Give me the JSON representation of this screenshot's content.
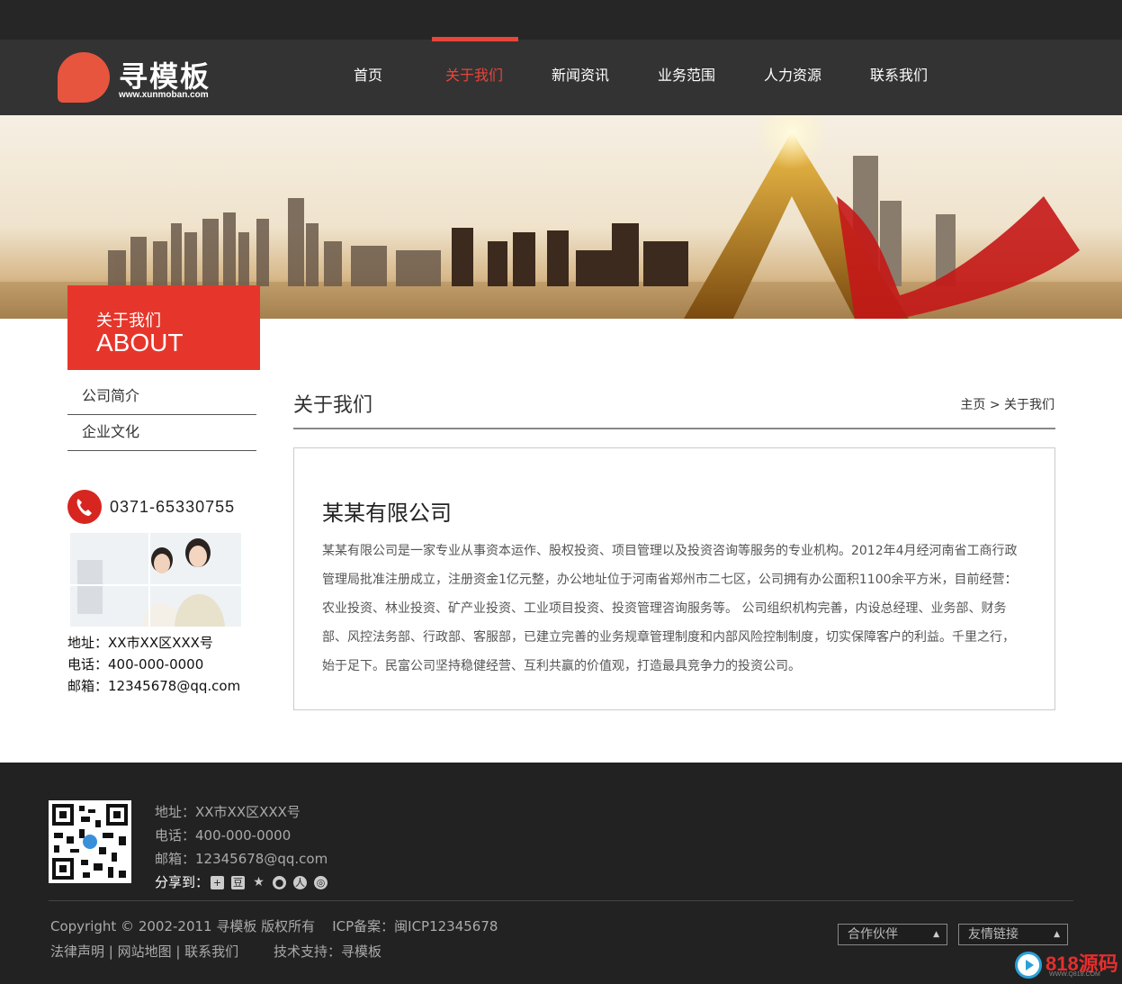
{
  "header": {
    "logo_text": "寻模板",
    "logo_url_text": "www.xunmoban.com",
    "nav": [
      {
        "label": "首页",
        "active": false
      },
      {
        "label": "关于我们",
        "active": true
      },
      {
        "label": "新闻资讯",
        "active": false
      },
      {
        "label": "业务范围",
        "active": false
      },
      {
        "label": "人力资源",
        "active": false
      },
      {
        "label": "联系我们",
        "active": false
      }
    ]
  },
  "sidebar": {
    "about_cn": "关于我们",
    "about_en": "ABOUT",
    "menu": [
      {
        "label": "公司简介"
      },
      {
        "label": "企业文化"
      }
    ],
    "phone": "0371-65330755",
    "address": "地址：XX市XX区XXX号",
    "tel": "电话：400-000-0000",
    "email": "邮箱：12345678@qq.com"
  },
  "content": {
    "title": "关于我们",
    "breadcrumb_home": "主页",
    "breadcrumb_sep": ">",
    "breadcrumb_current": "关于我们",
    "company_name": "某某有限公司",
    "description": "某某有限公司是一家专业从事资本运作、股权投资、项目管理以及投资咨询等服务的专业机构。2012年4月经河南省工商行政管理局批准注册成立，注册资金1亿元整，办公地址位于河南省郑州市二七区，公司拥有办公面积1100余平方米，目前经营：农业投资、林业投资、矿产业投资、工业项目投资、投资管理咨询服务等。 公司组织机构完善，内设总经理、业务部、财务部、风控法务部、行政部、客服部，已建立完善的业务规章管理制度和内部风险控制制度，切实保障客户的利益。千里之行，始于足下。民富公司坚持稳健经营、互利共赢的价值观，打造最具竞争力的投资公司。"
  },
  "footer": {
    "address": "地址：XX市XX区XXX号",
    "tel": "电话：400-000-0000",
    "email": "邮箱：12345678@qq.com",
    "share_label": "分享到：",
    "copyright": "Copyright © 2002-2011 寻模板 版权所有    ICP备案：闽ICP12345678",
    "links": "法律声明 | 网站地图 | 联系我们",
    "tech_support": "技术支持：寻模板",
    "partners_label": "合作伙伴",
    "friend_links_label": "友情链接"
  },
  "watermark": {
    "text": "818源码",
    "sub": "WWW.Q818.COM"
  },
  "colors": {
    "accent": "#e6362b",
    "header_bg": "#333333",
    "footer_bg": "#222222"
  }
}
